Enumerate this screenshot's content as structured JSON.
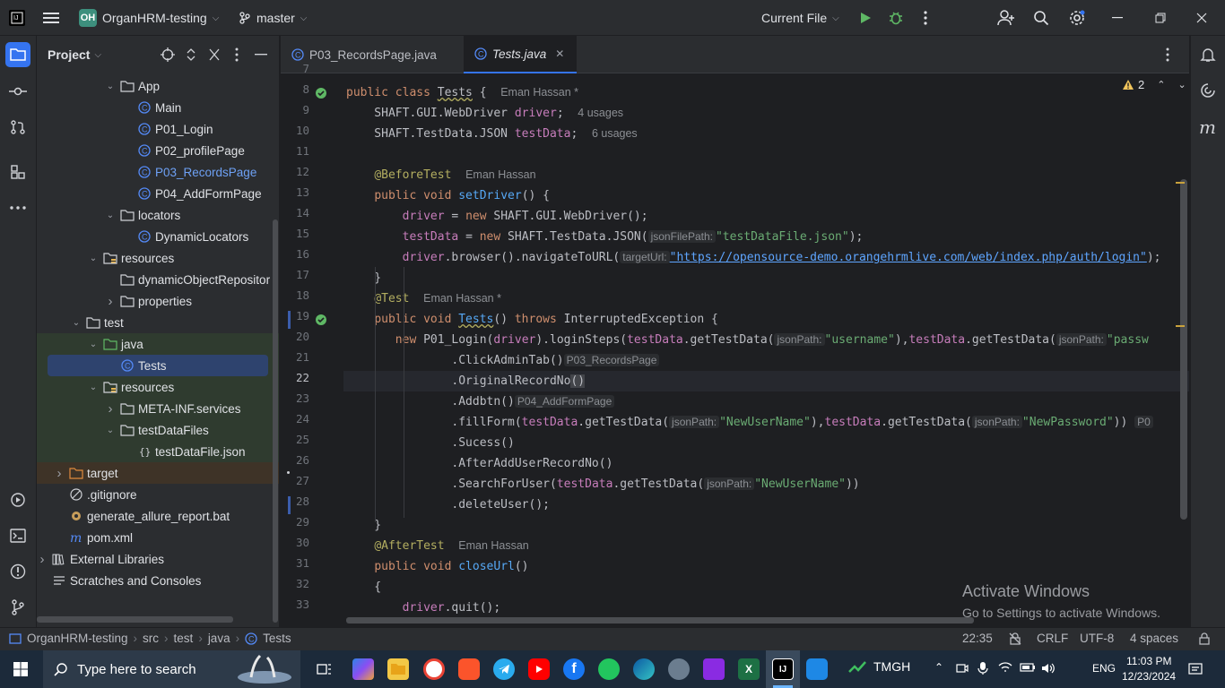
{
  "titlebar": {
    "project_badge": "OH",
    "project_name": "OrganHRM-testing",
    "branch": "master",
    "run_config": "Current File"
  },
  "tool_window": {
    "title": "Project"
  },
  "tree": [
    {
      "label": "App",
      "type": "folder",
      "indent": 1,
      "expanded": true
    },
    {
      "label": "Main",
      "type": "class",
      "indent": 2
    },
    {
      "label": "P01_Login",
      "type": "class",
      "indent": 2
    },
    {
      "label": "P02_profilePage",
      "type": "class",
      "indent": 2
    },
    {
      "label": "P03_RecordsPage",
      "type": "class",
      "indent": 2,
      "highlight": true
    },
    {
      "label": "P04_AddFormPage",
      "type": "class",
      "indent": 2
    },
    {
      "label": "locators",
      "type": "folder",
      "indent": 1,
      "expanded": true
    },
    {
      "label": "DynamicLocators",
      "type": "class",
      "indent": 2
    },
    {
      "label": "resources",
      "type": "resfolder",
      "indent": 0,
      "expanded": true
    },
    {
      "label": "dynamicObjectRepositor",
      "type": "folder",
      "indent": 1
    },
    {
      "label": "properties",
      "type": "folder",
      "indent": 1,
      "collapsed": true
    },
    {
      "label": "test",
      "type": "folder",
      "indent": -1,
      "expanded": true
    },
    {
      "label": "java",
      "type": "testfolder",
      "indent": 0,
      "expanded": true
    },
    {
      "label": "Tests",
      "type": "class",
      "indent": 1,
      "selected": true
    },
    {
      "label": "resources",
      "type": "resfolder",
      "indent": 0,
      "expanded": true
    },
    {
      "label": "META-INF.services",
      "type": "folder",
      "indent": 1,
      "collapsed": true
    },
    {
      "label": "testDataFiles",
      "type": "folder",
      "indent": 1,
      "expanded": true
    },
    {
      "label": "testDataFile.json",
      "type": "json",
      "indent": 2
    },
    {
      "label": "target",
      "type": "orangefolder",
      "indent": -2,
      "collapsed": true
    },
    {
      "label": ".gitignore",
      "type": "ignore",
      "indent": -2
    },
    {
      "label": "generate_allure_report.bat",
      "type": "bat",
      "indent": -2
    },
    {
      "label": "pom.xml",
      "type": "maven",
      "indent": -2
    },
    {
      "label": "External Libraries",
      "type": "lib",
      "indent": -3,
      "collapsed": true
    },
    {
      "label": "Scratches and Consoles",
      "type": "scratch",
      "indent": -3
    }
  ],
  "tabs": [
    {
      "label": "P03_RecordsPage.java",
      "active": false
    },
    {
      "label": "Tests.java",
      "active": true
    }
  ],
  "editor": {
    "problems_count": "2",
    "line_numbers": [
      "7",
      "8",
      "9",
      "10",
      "11",
      "12",
      "13",
      "14",
      "15",
      "16",
      "17",
      "18",
      "19",
      "20",
      "21",
      "22",
      "23",
      "24",
      "25",
      "26",
      "27",
      "28",
      "29",
      "30",
      "31",
      "32",
      "33"
    ],
    "author_a": "Eman Hassan *",
    "author_b": "Eman Hassan",
    "usages_driver": "4 usages",
    "usages_testdata": "6 usages",
    "hint_jsonFilePath": "jsonFilePath:",
    "hint_targetUrl": "targetUrl:",
    "hint_jsonPath": "jsonPath:",
    "str_datafile": "\"testDataFile.json\"",
    "str_url": "\"https://opensource-demo.orangehrmlive.com/web/index.php/auth/login\"",
    "str_username": "\"username\"",
    "str_passw": "\"passw",
    "str_newuser": "\"NewUserName\"",
    "str_newpass": "\"NewPassword\"",
    "type_hint_p03": "P03_RecordsPage",
    "type_hint_p04": "P04_AddFormPage",
    "type_hint_p0": "P0"
  },
  "watermark": {
    "line1": "Activate Windows",
    "line2": "Go to Settings to activate Windows."
  },
  "statusbar": {
    "breadcrumb": [
      "OrganHRM-testing",
      "src",
      "test",
      "java",
      "Tests"
    ],
    "position": "22:35",
    "line_sep": "CRLF",
    "encoding": "UTF-8",
    "indent": "4 spaces"
  },
  "taskbar": {
    "search_placeholder": "Type here to search",
    "app_label": "TMGH",
    "lang": "ENG",
    "time": "11:03 PM",
    "date": "12/23/2024"
  }
}
